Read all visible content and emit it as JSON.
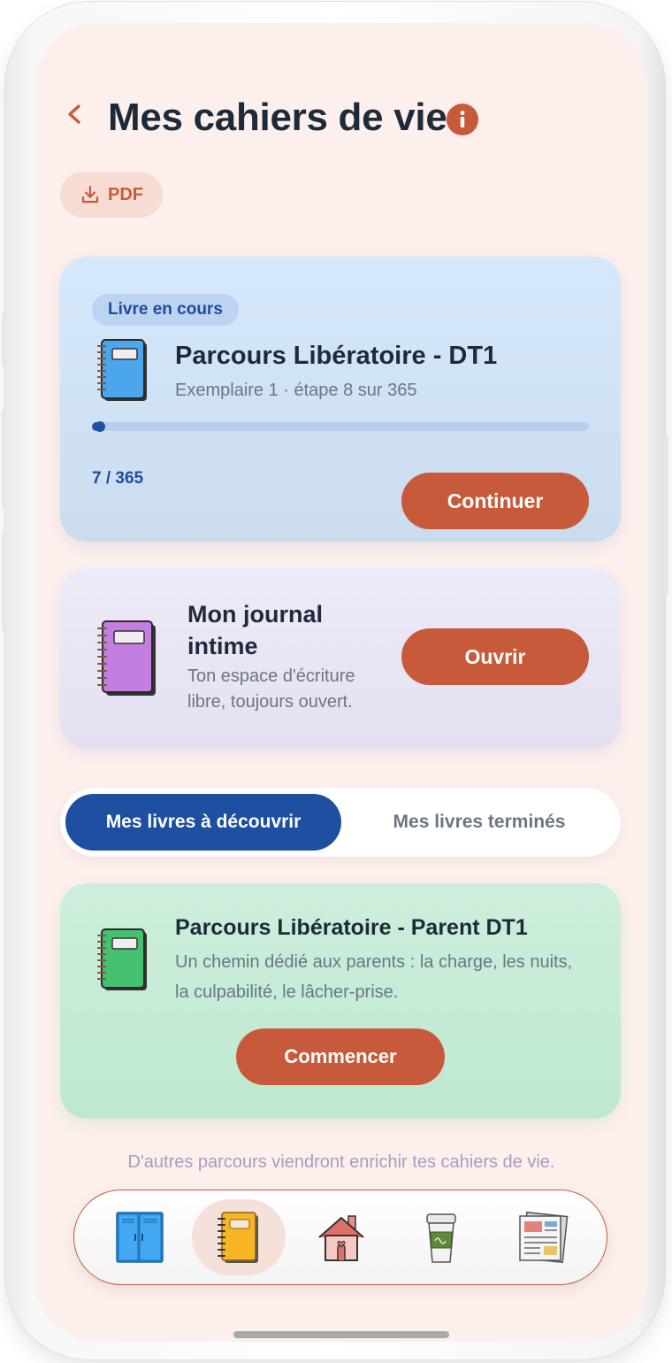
{
  "header": {
    "title": "Mes cahiers de vie",
    "pdf_label": "PDF"
  },
  "current_book": {
    "badge": "Livre en cours",
    "title": "Parcours Libératoire - DT1",
    "subtitle": "Exemplaire 1 · étape 8 sur 365",
    "progress_text": "7 / 365",
    "progress_value": 7,
    "progress_total": 365,
    "button": "Continuer"
  },
  "journal": {
    "title": "Mon journal intime",
    "subtitle": "Ton espace d'écriture libre, toujours ouvert.",
    "button": "Ouvrir"
  },
  "tabs": [
    {
      "label": "Mes livres à découvrir",
      "active": true
    },
    {
      "label": "Mes livres terminés",
      "active": false
    }
  ],
  "discover_book": {
    "title": "Parcours Libératoire - Parent DT1",
    "subtitle": "Un chemin dédié aux parents : la charge, les nuits, la culpabilité, le lâcher-prise.",
    "button": "Commencer"
  },
  "footer_note": "D'autres parcours viendront enrichir tes cahiers de vie.",
  "bottom_nav": [
    {
      "icon": "locker-icon",
      "active": false
    },
    {
      "icon": "notebook-icon",
      "active": true
    },
    {
      "icon": "house-icon",
      "active": false
    },
    {
      "icon": "coffee-cup-icon",
      "active": false
    },
    {
      "icon": "newspaper-icon",
      "active": false
    }
  ],
  "colors": {
    "accent": "#c85a3c",
    "primary_blue": "#1f4fa0",
    "background": "#fdf0ec",
    "text_dark": "#1e2a3a",
    "text_muted": "#6b7684"
  }
}
